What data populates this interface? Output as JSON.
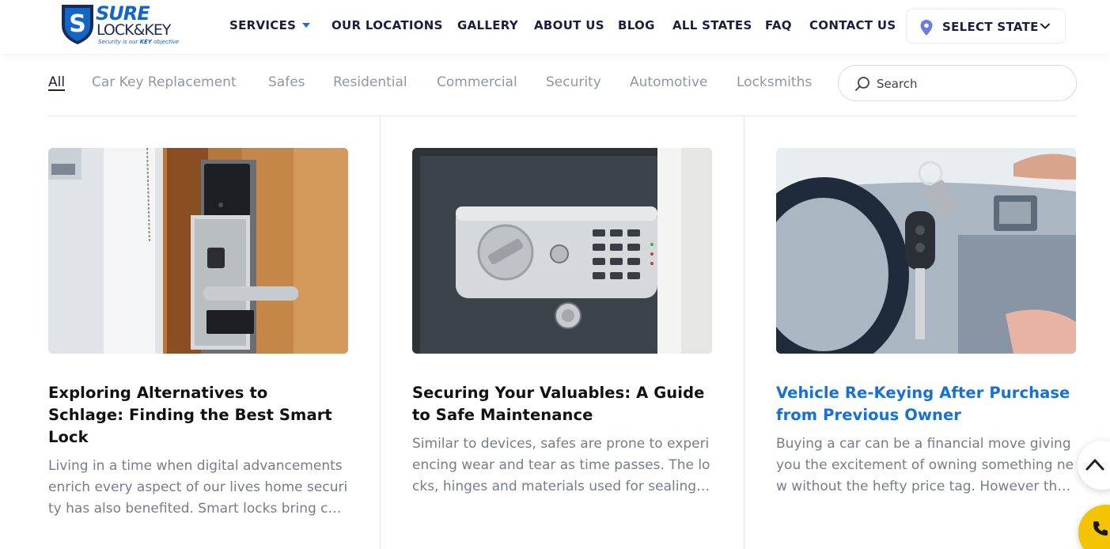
{
  "brand": {
    "name_top": "SURE",
    "name_mid": "LOCK&KEY",
    "tagline_pre": "Security is our ",
    "tagline_key": "KEY",
    "tagline_post": " objective"
  },
  "nav": {
    "items": [
      {
        "label": "SERVICES",
        "has_dropdown": true
      },
      {
        "label": "OUR LOCATIONS"
      },
      {
        "label": "GALLERY"
      },
      {
        "label": "ABOUT US"
      },
      {
        "label": "BLOG"
      },
      {
        "label": "ALL STATES"
      },
      {
        "label": "FAQ"
      },
      {
        "label": "CONTACT US"
      }
    ],
    "state_select": {
      "label": "SELECT STATE",
      "icon": "map-pin-icon"
    }
  },
  "filters": {
    "items": [
      {
        "label": "All",
        "active": true
      },
      {
        "label": "Car Key Replacement"
      },
      {
        "label": "Safes"
      },
      {
        "label": "Residential"
      },
      {
        "label": "Commercial"
      },
      {
        "label": "Security"
      },
      {
        "label": "Automotive"
      },
      {
        "label": "Locksmiths"
      }
    ],
    "search": {
      "placeholder": "Search",
      "value": ""
    }
  },
  "posts": [
    {
      "title": "Exploring Alternatives to Schlage: Finding the Best Smart Lock",
      "excerpt": "Living in a time when digital advancements enrich every aspect of our lives home security has also benefited. Smart locks bring convenience to our homes",
      "image": "smart-door-lock-photo",
      "highlighted": false
    },
    {
      "title": "Securing Your Valuables: A Guide to Safe Maintenance",
      "excerpt": "Similar to devices, safes are prone to experiencing wear and tear as time passes. The locks, hinges and materials used for sealing them",
      "image": "digital-safe-photo",
      "highlighted": false
    },
    {
      "title": "Vehicle Re-Keying After Purchase from Previous Owner",
      "excerpt": "Buying a car can be a financial move giving you the excitement of owning something new without the hefty price tag. However there are",
      "image": "car-key-handover-photo",
      "highlighted": true
    }
  ],
  "floating": {
    "scroll_top_icon": "chevron-up-icon",
    "call_icon": "phone-icon"
  },
  "colors": {
    "accent": "#1670d8",
    "nav_text": "#1b1e3c",
    "muted_text": "#767c8a",
    "call_button": "#f5c400"
  }
}
